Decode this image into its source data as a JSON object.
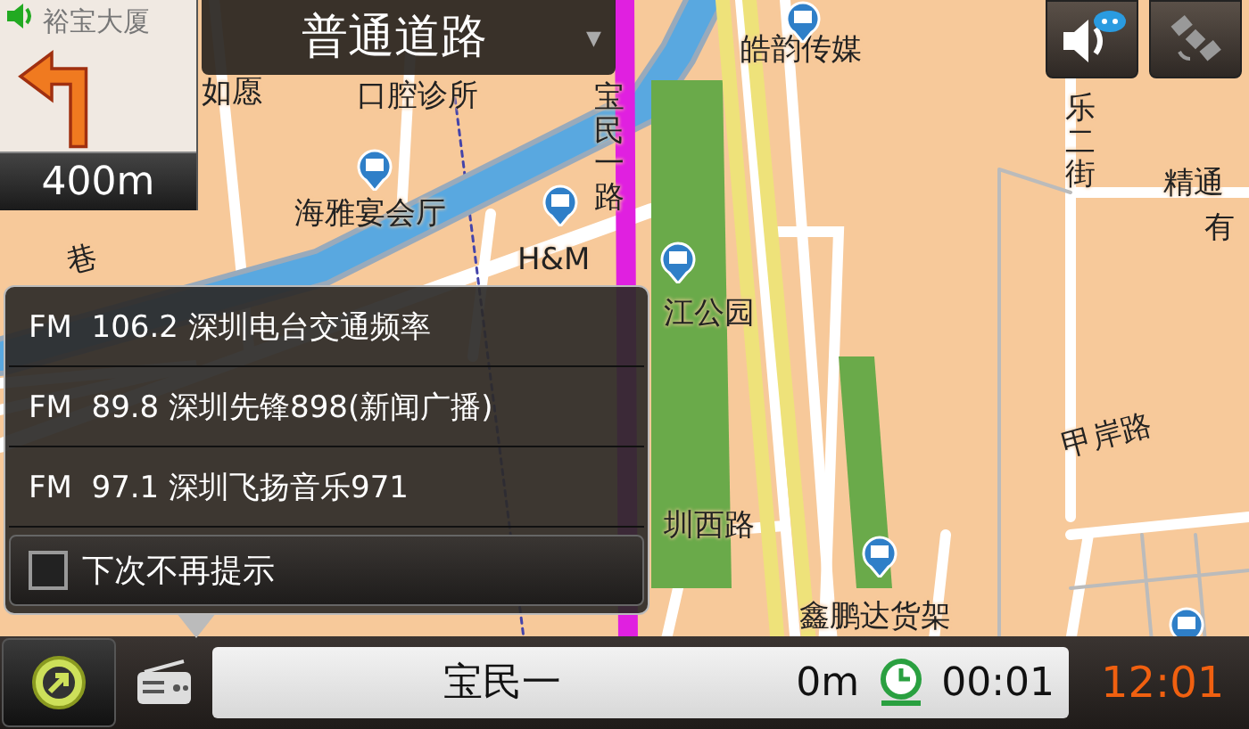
{
  "map": {
    "labels": [
      {
        "text": "如愿",
        "kind": "horizontal"
      },
      {
        "text": "口腔诊所",
        "kind": "horizontal"
      },
      {
        "text": "海雅宴会厅",
        "kind": "horizontal"
      },
      {
        "text": "H&M",
        "kind": "horizontal"
      },
      {
        "text": "宝民一路",
        "kind": "vertical"
      },
      {
        "text": "皓韵传媒",
        "kind": "horizontal"
      },
      {
        "text": "乐二街",
        "kind": "vertical"
      },
      {
        "text": "精通",
        "kind": "horizontal"
      },
      {
        "text": "有",
        "kind": "horizontal"
      },
      {
        "text": "江公园",
        "kind": "horizontal"
      },
      {
        "text": "圳西路",
        "kind": "horizontal"
      },
      {
        "text": "甲岸路",
        "kind": "tilted"
      },
      {
        "text": "鑫鹏达货架",
        "kind": "horizontal"
      },
      {
        "text": "巷",
        "kind": "tilted"
      }
    ]
  },
  "turn": {
    "background_label": "裕宝大厦",
    "distance": "400m"
  },
  "road_bar": {
    "title": "普通道路",
    "caret": "▼"
  },
  "radio_popup": {
    "stations": [
      {
        "band": "FM",
        "frequency": "106.2",
        "name": "深圳电台交通频率"
      },
      {
        "band": "FM",
        "frequency": "89.8",
        "name": "深圳先锋898(新闻广播)"
      },
      {
        "band": "FM",
        "frequency": "97.1",
        "name": "深圳飞扬音乐971"
      }
    ],
    "dont_show_again": {
      "label": "下次不再提示",
      "checked": false
    }
  },
  "bottom_bar": {
    "road": "宝民一",
    "distance": "0m",
    "elapsed": "00:01",
    "clock": "12:01"
  }
}
